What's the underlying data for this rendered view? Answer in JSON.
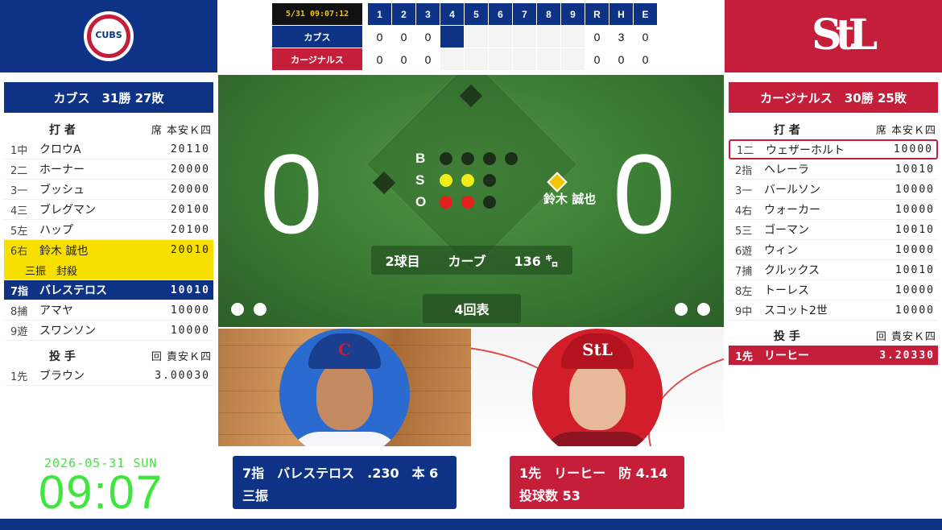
{
  "colors": {
    "away": "#0e3386",
    "home": "#c41e3a",
    "highlight": "#f7e000",
    "clock": "#3ee63e"
  },
  "teams": {
    "away": {
      "logo_text": "CUBS",
      "record": "カブス　31勝 27敗"
    },
    "home": {
      "logo_text": "StL",
      "record": "カージナルス　30勝 25敗"
    }
  },
  "linescore": {
    "timestamp": "5/31 09:07:12",
    "headers": [
      "1",
      "2",
      "3",
      "4",
      "5",
      "6",
      "7",
      "8",
      "9",
      "R",
      "H",
      "E"
    ],
    "away": {
      "name": "カブス",
      "innings": [
        "0",
        "0",
        "0",
        "",
        "",
        "",
        "",
        "",
        ""
      ],
      "rhe": [
        "0",
        "3",
        "0"
      ]
    },
    "home": {
      "name": "カージナルス",
      "innings": [
        "0",
        "0",
        "0",
        "",
        "",
        "",
        "",
        "",
        ""
      ],
      "rhe": [
        "0",
        "0",
        "0"
      ]
    }
  },
  "away_lineup": {
    "header": {
      "batter": "打 者",
      "cols": "席 本安Ｋ四"
    },
    "batters": [
      {
        "pos": "1中",
        "name": "クロウA",
        "stats": "20110"
      },
      {
        "pos": "2二",
        "name": "ホーナー",
        "stats": "20000"
      },
      {
        "pos": "3一",
        "name": "ブッシュ",
        "stats": "20000"
      },
      {
        "pos": "4三",
        "name": "ブレグマン",
        "stats": "20100"
      },
      {
        "pos": "5左",
        "name": "ハップ",
        "stats": "20100"
      },
      {
        "pos": "6右",
        "name": "鈴木 誠也",
        "stats": "20010"
      },
      {
        "pos": "7指",
        "name": "バレステロス",
        "stats": "10010"
      },
      {
        "pos": "8捕",
        "name": "アマヤ",
        "stats": "10000"
      },
      {
        "pos": "9遊",
        "name": "スワンソン",
        "stats": "10000"
      }
    ],
    "sub_note": "三振　封殺",
    "pitch_header": {
      "label": "投 手",
      "cols": "回 責安Ｋ四"
    },
    "pitchers": [
      {
        "pos": "1先",
        "name": "ブラウン",
        "stats": "3.00030"
      }
    ]
  },
  "home_lineup": {
    "header": {
      "batter": "打 者",
      "cols": "席 本安Ｋ四"
    },
    "batters": [
      {
        "pos": "1二",
        "name": "ウェザーホルト",
        "stats": "10000"
      },
      {
        "pos": "2指",
        "name": "ヘレーラ",
        "stats": "10010"
      },
      {
        "pos": "3一",
        "name": "バールソン",
        "stats": "10000"
      },
      {
        "pos": "4右",
        "name": "ウォーカー",
        "stats": "10000"
      },
      {
        "pos": "5三",
        "name": "ゴーマン",
        "stats": "10010"
      },
      {
        "pos": "6遊",
        "name": "ウィン",
        "stats": "10000"
      },
      {
        "pos": "7捕",
        "name": "クルックス",
        "stats": "10010"
      },
      {
        "pos": "8左",
        "name": "トーレス",
        "stats": "10000"
      },
      {
        "pos": "9中",
        "name": "スコット2世",
        "stats": "10000"
      }
    ],
    "pitch_header": {
      "label": "投 手",
      "cols": "回 責安Ｋ四"
    },
    "pitchers": [
      {
        "pos": "1先",
        "name": "リーヒー",
        "stats": "3.20330"
      }
    ]
  },
  "field": {
    "score_away": "0",
    "score_home": "0",
    "runner_first": "鈴木 誠也",
    "bso_labels": {
      "b": "B",
      "s": "S",
      "o": "O"
    },
    "balls": 0,
    "strikes": 2,
    "outs": 2,
    "pitch_count": "2球目",
    "pitch_type": "カーブ",
    "pitch_speed": "136 ㌔",
    "inning": "4回表"
  },
  "photos": {
    "left_cap": "C",
    "right_cap": "StL"
  },
  "batter_info": {
    "line1": "7指　バレステロス　.230　本 6",
    "line2": "三振"
  },
  "pitcher_info": {
    "line1": "1先　リーヒー　防 4.14",
    "line2": "投球数 53"
  },
  "clock": {
    "date": "2026-05-31 SUN",
    "time": "09:07"
  }
}
